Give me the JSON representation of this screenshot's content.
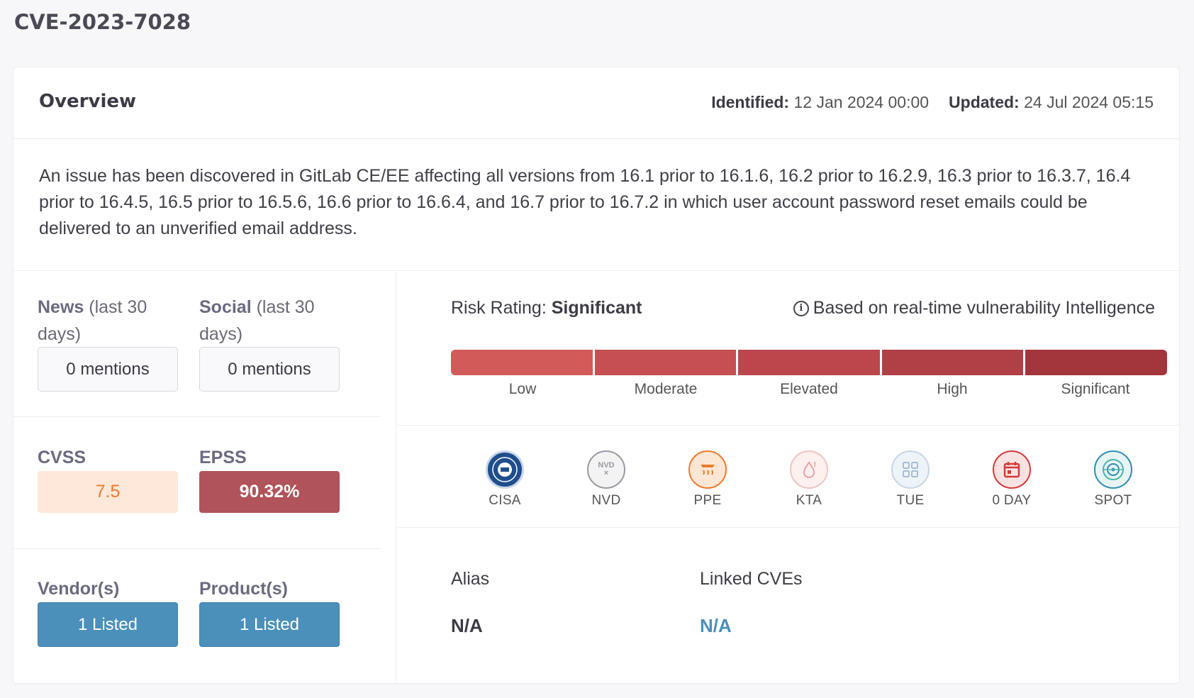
{
  "page": {
    "title": "CVE-2023-7028"
  },
  "overview": {
    "title": "Overview",
    "identified_label": "Identified:",
    "identified_value": "12 Jan 2024 00:00",
    "updated_label": "Updated:",
    "updated_value": "24 Jul 2024 05:15",
    "description": "An issue has been discovered in GitLab CE/EE affecting all versions from 16.1 prior to 16.1.6, 16.2 prior to 16.2.9, 16.3 prior to 16.3.7, 16.4 prior to 16.4.5, 16.5 prior to 16.5.6, 16.6 prior to 16.6.4, and 16.7 prior to 16.7.2 in which user account password reset emails could be delivered to an unverified email address."
  },
  "stats": {
    "news": {
      "label": "News",
      "suffix": " (last 30 days)",
      "value": "0 mentions"
    },
    "social": {
      "label": "Social",
      "suffix": " (last 30 days)",
      "value": "0 mentions"
    },
    "cvss": {
      "label": "CVSS",
      "value": "7.5"
    },
    "epss": {
      "label": "EPSS",
      "value": "90.32%"
    },
    "vendors": {
      "label": "Vendor(s)",
      "value": "1 Listed"
    },
    "products": {
      "label": "Product(s)",
      "value": "1 Listed"
    }
  },
  "risk": {
    "label": "Risk Rating:",
    "value": "Significant",
    "note_icon": "info-icon",
    "note": "Based on real-time vulnerability Intelligence",
    "levels": [
      "Low",
      "Moderate",
      "Elevated",
      "High",
      "Significant"
    ],
    "colors": [
      "#d25a58",
      "#c54f52",
      "#bb474d",
      "#b03f46",
      "#a3353d"
    ]
  },
  "sources": [
    {
      "label": "CISA",
      "icon": "cisa-seal-icon"
    },
    {
      "label": "NVD",
      "icon": "nvd-icon"
    },
    {
      "label": "PPE",
      "icon": "ppe-icon"
    },
    {
      "label": "KTA",
      "icon": "kta-icon"
    },
    {
      "label": "TUE",
      "icon": "tue-icon"
    },
    {
      "label": "0 DAY",
      "icon": "zero-day-icon"
    },
    {
      "label": "SPOT",
      "icon": "spot-icon"
    }
  ],
  "alias": {
    "label": "Alias",
    "value": "N/A"
  },
  "linked": {
    "label": "Linked CVEs",
    "value": "N/A"
  },
  "colors": {
    "accent": "#4a90ba",
    "epss": "#b1535a",
    "cvss_text": "#f07a2e",
    "cvss_bg": "#fde8d9"
  }
}
